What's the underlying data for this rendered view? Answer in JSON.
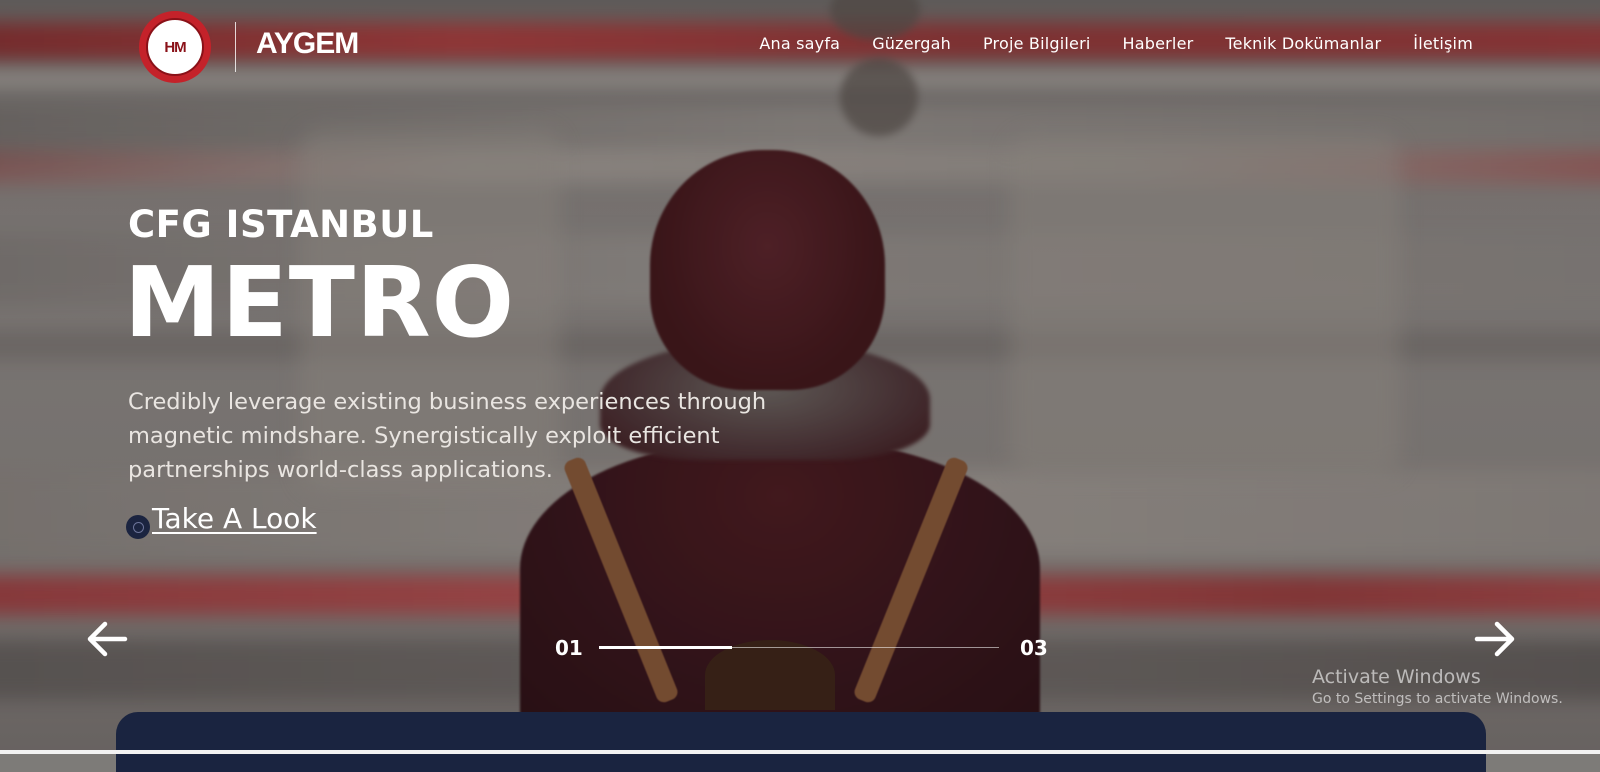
{
  "header": {
    "logo_alt": "Istanbul Yeni Havalimani Metro Projesi",
    "logo_mark": "HM",
    "brand": "AYGEM",
    "nav": [
      {
        "label": "Ana sayfa"
      },
      {
        "label": "Güzergah"
      },
      {
        "label": "Proje Bilgileri"
      },
      {
        "label": "Haberler"
      },
      {
        "label": "Teknik Dokümanlar"
      },
      {
        "label": "İletişim"
      }
    ]
  },
  "hero": {
    "subtitle": "CFG ISTANBUL",
    "title": "METRO",
    "description": "Credibly leverage existing business experiences through magnetic mindshare. Synergistically exploit efficient partnerships world-class applications.",
    "cta_label": "Take A Look"
  },
  "slider": {
    "current": "01",
    "total": "03",
    "progress": 0.333,
    "prev_icon": "arrow-left-icon",
    "next_icon": "arrow-right-icon"
  },
  "system": {
    "activate_title": "Activate Windows",
    "activate_sub": "Go to Settings to activate Windows."
  },
  "colors": {
    "accent_red": "#c4222a",
    "panel_navy": "#1a2440"
  }
}
